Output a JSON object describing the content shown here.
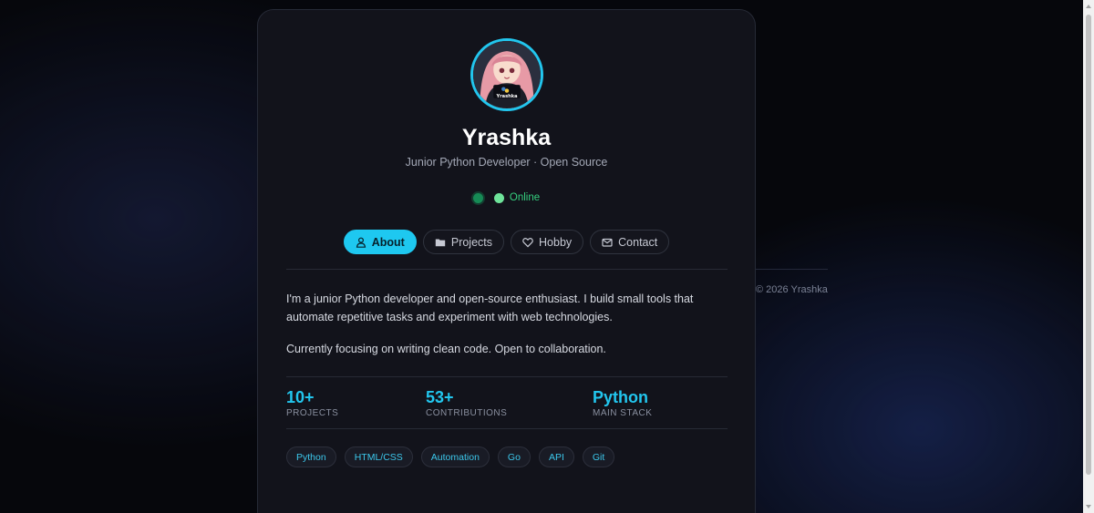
{
  "profile": {
    "name": "Yrashka",
    "subtitle": "Junior Python Developer · Open Source",
    "avatar_caption": "Yrashka",
    "status": "Online"
  },
  "tabs": [
    {
      "label": "About",
      "icon": "user-icon",
      "active": true
    },
    {
      "label": "Projects",
      "icon": "folder-icon",
      "active": false
    },
    {
      "label": "Hobby",
      "icon": "heart-icon",
      "active": false
    },
    {
      "label": "Contact",
      "icon": "mail-icon",
      "active": false
    }
  ],
  "about": {
    "paragraphs": [
      "I'm a junior Python developer and open-source enthusiast. I build small tools that automate repetitive tasks and experiment with web technologies.",
      "Currently focusing on writing clean code. Open to collaboration."
    ]
  },
  "stats": [
    {
      "value": "10+",
      "label": "PROJECTS"
    },
    {
      "value": "53+",
      "label": "CONTRIBUTIONS"
    },
    {
      "value": "Python",
      "label": "MAIN STACK"
    }
  ],
  "tags": [
    "Python",
    "HTML/CSS",
    "Automation",
    "Go",
    "API",
    "Git"
  ],
  "footer": {
    "copyright": "© 2026 Yrashka"
  },
  "colors": {
    "accent": "#1ec8f0",
    "status_online": "#35d07f",
    "card_bg": "#12131b"
  }
}
